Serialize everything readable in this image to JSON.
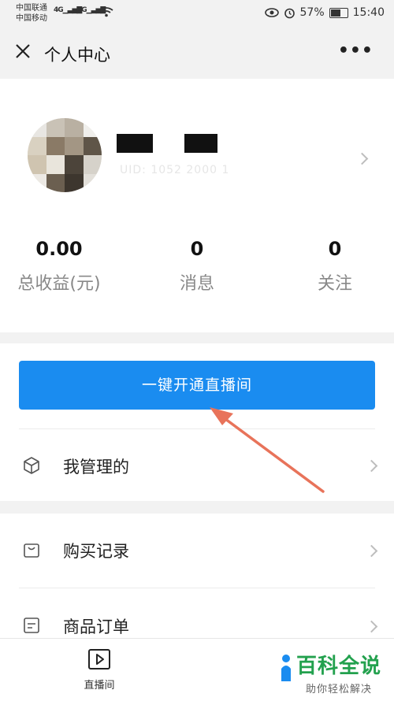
{
  "status_bar": {
    "carrier_1": "中国联通",
    "carrier_2": "中国移动",
    "net_1": "4G",
    "net_2": "2G",
    "battery": "57%",
    "time": "15:40"
  },
  "nav": {
    "title": "个人中心"
  },
  "profile": {
    "uid_masked": "UID: 1052 2000 1"
  },
  "stats": [
    {
      "value": "0.00",
      "label": "总收益(元)"
    },
    {
      "value": "0",
      "label": "消息"
    },
    {
      "value": "0",
      "label": "关注"
    }
  ],
  "actions": {
    "open_live_label": "一键开通直播间"
  },
  "menu": {
    "managed": "我管理的",
    "purchases": "购买记录",
    "orders": "商品订单"
  },
  "tabbar": {
    "live_label": "直播间"
  },
  "watermark": {
    "logo": "百科全说",
    "sub": "助你轻松解决"
  },
  "colors": {
    "accent": "#1a8cf0",
    "annotation_arrow": "#e8735a",
    "watermark_green": "#23a14e"
  }
}
